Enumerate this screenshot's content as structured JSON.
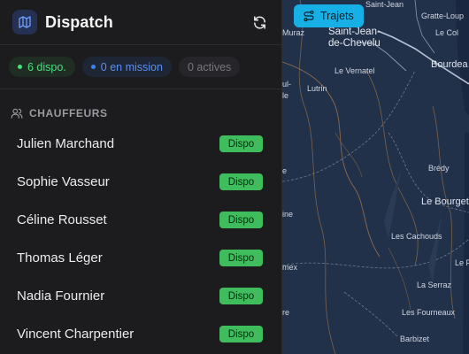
{
  "header": {
    "title": "Dispatch"
  },
  "stats": {
    "available": "6 dispo.",
    "in_mission": "0 en mission",
    "active": "0 actives"
  },
  "section": {
    "label": "CHAUFFEURS"
  },
  "drivers": [
    {
      "name": "Julien Marchand",
      "status": "Dispo"
    },
    {
      "name": "Sophie Vasseur",
      "status": "Dispo"
    },
    {
      "name": "Céline Rousset",
      "status": "Dispo"
    },
    {
      "name": "Thomas Léger",
      "status": "Dispo"
    },
    {
      "name": "Nadia Fournier",
      "status": "Dispo"
    },
    {
      "name": "Vincent Charpentier",
      "status": "Dispo"
    }
  ],
  "map": {
    "button_label": "Trajets",
    "labels": {
      "saint_jean": "Saint-Jean-",
      "de_chevelu": "de-Chevelu",
      "saint_jean_top": "Saint-Jean",
      "muraz": "Muraz",
      "gratteloup": "Gratte-Loup",
      "le_col": "Le Col",
      "bourdeau": "Bourdea",
      "le_vernatel": "Le Vernatel",
      "lutrin": "Lutrin",
      "ul": "ul-",
      "le": "le",
      "bredy": "Brédy",
      "le_bourget": "Le Bourget",
      "les_cachouds": "Les Cachouds",
      "le_pin": "Le Pin",
      "emex": "mex",
      "la_serraz": "La Serraz",
      "les_fourneaux": "Les Fourneaux",
      "barbizet": "Barbizet",
      "ine": "ine",
      "re": "re",
      "small_e": "e"
    }
  },
  "colors": {
    "accent": "#17b0e6",
    "dispo": "#3fbc5c",
    "available": "#4ade80",
    "mission": "#3b82f6"
  }
}
